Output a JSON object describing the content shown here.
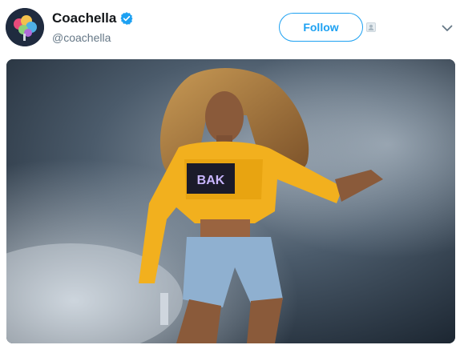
{
  "account": {
    "display_name": "Coachella",
    "handle": "@coachella",
    "verified": true
  },
  "actions": {
    "follow_label": "Follow"
  },
  "icons": {
    "verified": "verified-badge-icon",
    "follow_extra": "small-user-icon",
    "menu": "chevron-down-icon"
  },
  "colors": {
    "brand_blue": "#1da1f2",
    "text_primary": "#14171a",
    "text_secondary": "#657786"
  }
}
